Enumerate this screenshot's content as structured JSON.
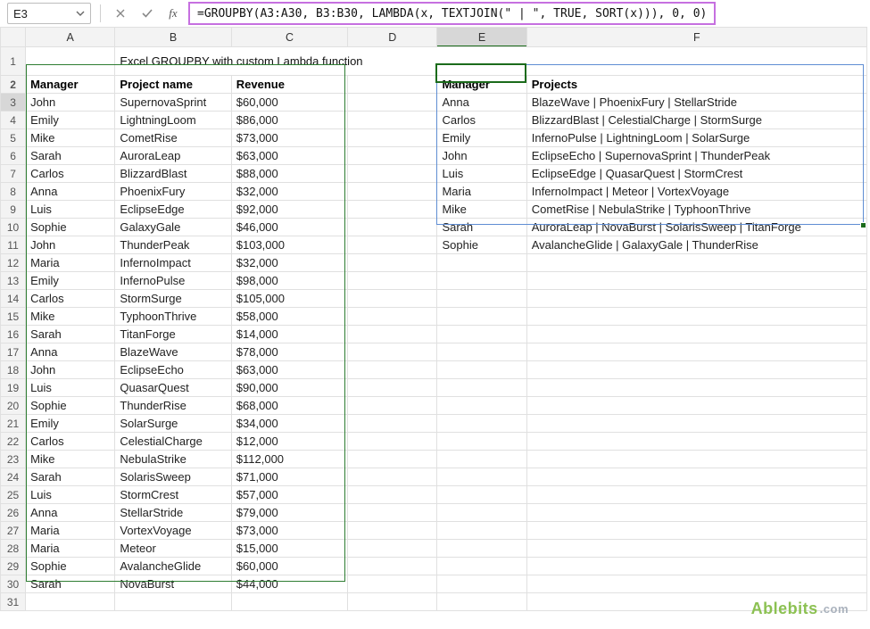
{
  "nameBox": "E3",
  "formula": "=GROUPBY(A3:A30, B3:B30, LAMBDA(x, TEXTJOIN(\" | \", TRUE, SORT(x))), 0, 0)",
  "title": "Excel GROUPBY with custom Lambda function",
  "columns": [
    "A",
    "B",
    "C",
    "D",
    "E",
    "F"
  ],
  "headers": {
    "A": "Manager",
    "B": "Project name",
    "C": "Revenue",
    "E": "Manager",
    "F": "Projects"
  },
  "sourceRows": [
    {
      "m": "John",
      "p": "SupernovaSprint",
      "r": "$60,000"
    },
    {
      "m": "Emily",
      "p": "LightningLoom",
      "r": "$86,000"
    },
    {
      "m": "Mike",
      "p": "CometRise",
      "r": "$73,000"
    },
    {
      "m": "Sarah",
      "p": "AuroraLeap",
      "r": "$63,000"
    },
    {
      "m": "Carlos",
      "p": "BlizzardBlast",
      "r": "$88,000"
    },
    {
      "m": "Anna",
      "p": "PhoenixFury",
      "r": "$32,000"
    },
    {
      "m": "Luis",
      "p": "EclipseEdge",
      "r": "$92,000"
    },
    {
      "m": "Sophie",
      "p": "GalaxyGale",
      "r": "$46,000"
    },
    {
      "m": "John",
      "p": "ThunderPeak",
      "r": "$103,000"
    },
    {
      "m": "Maria",
      "p": "InfernoImpact",
      "r": "$32,000"
    },
    {
      "m": "Emily",
      "p": "InfernoPulse",
      "r": "$98,000"
    },
    {
      "m": "Carlos",
      "p": "StormSurge",
      "r": "$105,000"
    },
    {
      "m": "Mike",
      "p": "TyphoonThrive",
      "r": "$58,000"
    },
    {
      "m": "Sarah",
      "p": "TitanForge",
      "r": "$14,000"
    },
    {
      "m": "Anna",
      "p": "BlazeWave",
      "r": "$78,000"
    },
    {
      "m": "John",
      "p": "EclipseEcho",
      "r": "$63,000"
    },
    {
      "m": "Luis",
      "p": "QuasarQuest",
      "r": "$90,000"
    },
    {
      "m": "Sophie",
      "p": "ThunderRise",
      "r": "$68,000"
    },
    {
      "m": "Emily",
      "p": "SolarSurge",
      "r": "$34,000"
    },
    {
      "m": "Carlos",
      "p": "CelestialCharge",
      "r": "$12,000"
    },
    {
      "m": "Mike",
      "p": "NebulaStrike",
      "r": "$112,000"
    },
    {
      "m": "Sarah",
      "p": "SolarisSweep",
      "r": "$71,000"
    },
    {
      "m": "Luis",
      "p": "StormCrest",
      "r": "$57,000"
    },
    {
      "m": "Anna",
      "p": "StellarStride",
      "r": "$79,000"
    },
    {
      "m": "Maria",
      "p": "VortexVoyage",
      "r": "$73,000"
    },
    {
      "m": "Maria",
      "p": "Meteor",
      "r": "$15,000"
    },
    {
      "m": "Sophie",
      "p": "AvalancheGlide",
      "r": "$60,000"
    },
    {
      "m": "Sarah",
      "p": "NovaBurst",
      "r": "$44,000"
    }
  ],
  "resultRows": [
    {
      "m": "Anna",
      "p": "BlazeWave | PhoenixFury | StellarStride"
    },
    {
      "m": "Carlos",
      "p": "BlizzardBlast | CelestialCharge | StormSurge"
    },
    {
      "m": "Emily",
      "p": "InfernoPulse | LightningLoom | SolarSurge"
    },
    {
      "m": "John",
      "p": "EclipseEcho | SupernovaSprint | ThunderPeak"
    },
    {
      "m": "Luis",
      "p": "EclipseEdge | QuasarQuest | StormCrest"
    },
    {
      "m": "Maria",
      "p": "InfernoImpact | Meteor | VortexVoyage"
    },
    {
      "m": "Mike",
      "p": "CometRise | NebulaStrike | TyphoonThrive"
    },
    {
      "m": "Sarah",
      "p": "AuroraLeap | NovaBurst | SolarisSweep | TitanForge"
    },
    {
      "m": "Sophie",
      "p": "AvalancheGlide | GalaxyGale | ThunderRise"
    }
  ],
  "watermark": {
    "a": "Ablebits",
    "b": ".com"
  },
  "icons": {
    "chevron": "chevron-down-icon",
    "cancel": "cancel-icon",
    "accept": "accept-icon",
    "fx": "fx-icon"
  }
}
